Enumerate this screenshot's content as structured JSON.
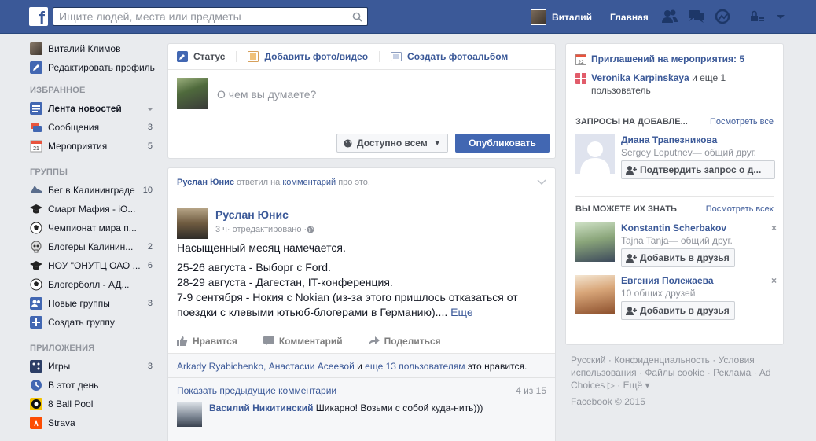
{
  "topbar": {
    "logo": "f",
    "search_placeholder": "Ищите людей, места или предметы",
    "user_name": "Виталий",
    "home_label": "Главная",
    "icons": [
      "friends-icon",
      "messages-icon",
      "notifications-icon",
      "privacy-icon",
      "account-menu-icon"
    ]
  },
  "left_nav": {
    "profile": {
      "name": "Виталий Климов",
      "edit_label": "Редактировать профиль"
    },
    "favorites_header": "ИЗБРАННОЕ",
    "favorites": [
      {
        "label": "Лента новостей",
        "count": "",
        "icon": "news-feed-icon"
      },
      {
        "label": "Сообщения",
        "count": "3",
        "icon": "messages-icon"
      },
      {
        "label": "Мероприятия",
        "count": "5",
        "icon": "calendar-icon"
      }
    ],
    "groups_header": "ГРУППЫ",
    "groups": [
      {
        "label": "Бег в Калининграде",
        "count": "10"
      },
      {
        "label": "Смарт Мафия - iO...",
        "count": ""
      },
      {
        "label": "Чемпионат мира п...",
        "count": ""
      },
      {
        "label": "Блогеры Калинин...",
        "count": "2"
      },
      {
        "label": "НОУ \"ОНУТЦ ОАО ...",
        "count": "6"
      },
      {
        "label": "Блогерболл - АД...",
        "count": ""
      },
      {
        "label": "Новые группы",
        "count": "3"
      },
      {
        "label": "Создать группу",
        "count": ""
      }
    ],
    "apps_header": "ПРИЛОЖЕНИЯ",
    "apps": [
      {
        "label": "Игры",
        "count": "3"
      },
      {
        "label": "В этот день",
        "count": ""
      },
      {
        "label": "8 Ball Pool",
        "count": ""
      },
      {
        "label": "Strava",
        "count": ""
      }
    ]
  },
  "composer": {
    "tab_status": "Статус",
    "tab_photo": "Добавить фото/видео",
    "tab_album": "Создать фотоальбом",
    "placeholder": "О чем вы думаете?",
    "audience": "Доступно всем",
    "publish": "Опубликовать"
  },
  "post": {
    "story_actor": "Руслан Юнис",
    "story_middle": " ответил на ",
    "story_link": "комментарий",
    "story_end": " про это.",
    "author": "Руслан Юнис",
    "time": "3 ч",
    "edited": " · отредактировано · ",
    "paragraphs": [
      "Насыщенный месяц намечается.",
      "25-26 августа - Выборг с Ford.",
      "28-29 августа - Дагестан, IT-конференция.",
      "7-9 сентября - Нокия с Nokian (из-за этого пришлось отказаться от поездки с клевыми ютьюб-блогерами в Германию)...."
    ],
    "more": "Еще",
    "like": "Нравится",
    "comment": "Комментарий",
    "share": "Поделиться",
    "likes_names": "Arkady Ryabichenko, Анастасии Асеевой",
    "likes_middle": " и ",
    "likes_others": "еще 13 пользователям",
    "likes_end": " это нравится.",
    "prev_comments": "Показать предыдущие комментарии",
    "comments_count": "4 из 15",
    "comment_author": "Василий Никитинский",
    "comment_text": " Шикарно! Возьми с собой куда-нить)))"
  },
  "right": {
    "events_label": "Приглашений на мероприятия: 5",
    "bday_name": "Veronika Karpinskaya",
    "bday_rest": " и еще 1 пользователь",
    "requests_header": "ЗАПРОСЫ НА ДОБАВЛЕ...",
    "requests_see_all": "Посмотреть все",
    "request": {
      "name": "Диана Трапезникова",
      "sub": "Sergey Loputnev— общий друг.",
      "button": "Подтвердить запрос о д..."
    },
    "pymk_header": "ВЫ МОЖЕТЕ ИХ ЗНАТЬ",
    "pymk_see_all": "Посмотреть всех",
    "pymk": [
      {
        "name": "Konstantin Scherbakov",
        "sub": "Tajna Tanja— общий друг.",
        "button": "Добавить в друзья"
      },
      {
        "name": "Евгения Полежаева",
        "sub": "10 общих друзей",
        "button": "Добавить в друзья"
      }
    ],
    "remove_label": "×"
  },
  "footer": {
    "line1": "Русский · Конфиденциальность · Условия использования · Файлы cookie · Реклама · Ad Choices ▷ · Ещё ▾",
    "copyright": "Facebook © 2015"
  },
  "colors": {
    "brand": "#3b5998",
    "publish": "#4267b2",
    "background": "#e9ebee"
  }
}
